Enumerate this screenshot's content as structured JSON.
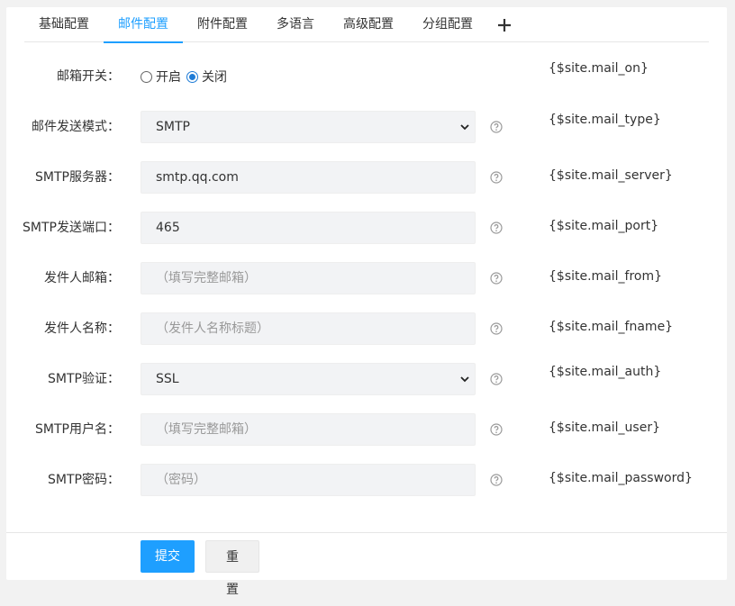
{
  "tabs": [
    {
      "label": "基础配置",
      "active": false
    },
    {
      "label": "邮件配置",
      "active": true
    },
    {
      "label": "附件配置",
      "active": false
    },
    {
      "label": "多语言",
      "active": false
    },
    {
      "label": "高级配置",
      "active": false
    },
    {
      "label": "分组配置",
      "active": false
    }
  ],
  "tab_add_icon": "plus-icon",
  "form": {
    "mail_on": {
      "label": "邮箱开关：",
      "options": [
        {
          "label": "开启",
          "checked": false
        },
        {
          "label": "关闭",
          "checked": true
        }
      ],
      "var": "{$site.mail_on}"
    },
    "mail_type": {
      "label": "邮件发送模式：",
      "value": "SMTP",
      "var": "{$site.mail_type}"
    },
    "mail_server": {
      "label": "SMTP服务器：",
      "value": "smtp.qq.com",
      "placeholder": "",
      "var": "{$site.mail_server}"
    },
    "mail_port": {
      "label": "SMTP发送端口：",
      "value": "465",
      "placeholder": "",
      "var": "{$site.mail_port}"
    },
    "mail_from": {
      "label": "发件人邮箱：",
      "value": "",
      "placeholder": "（填写完整邮箱）",
      "var": "{$site.mail_from}"
    },
    "mail_fname": {
      "label": "发件人名称：",
      "value": "",
      "placeholder": "（发件人名称标题）",
      "var": "{$site.mail_fname}"
    },
    "mail_auth": {
      "label": "SMTP验证：",
      "value": "SSL",
      "var": "{$site.mail_auth}"
    },
    "mail_user": {
      "label": "SMTP用户名：",
      "value": "",
      "placeholder": "（填写完整邮箱）",
      "var": "{$site.mail_user}"
    },
    "mail_password": {
      "label": "SMTP密码：",
      "value": "",
      "placeholder": "（密码）",
      "var": "{$site.mail_password}"
    }
  },
  "help_icon": "question-circle-icon",
  "buttons": {
    "submit": "提交",
    "reset": "重置"
  },
  "colors": {
    "accent": "#1e9fff",
    "input_bg": "#f2f3f5",
    "page_bg": "#f2f2f2"
  }
}
